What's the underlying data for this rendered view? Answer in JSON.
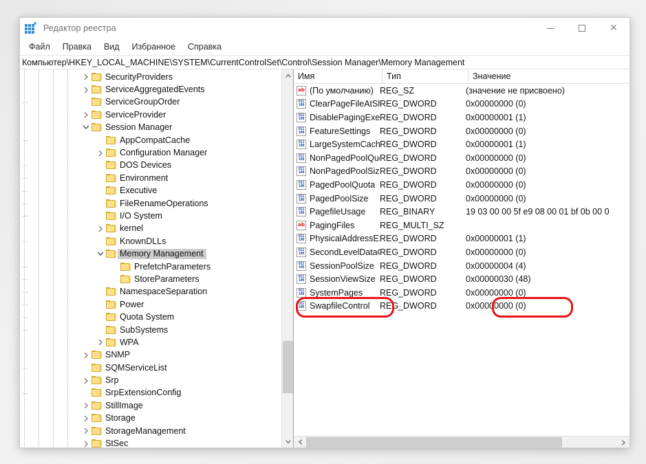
{
  "window": {
    "app_icon": "registry-editor-icon",
    "title": "Редактор реестра",
    "controls": {
      "minimize": "—",
      "maximize": "▢",
      "close": "✕"
    }
  },
  "menu": {
    "items": [
      {
        "label": "Файл"
      },
      {
        "label": "Правка"
      },
      {
        "label": "Вид"
      },
      {
        "label": "Избранное"
      },
      {
        "label": "Справка"
      }
    ]
  },
  "address": {
    "path": "Компьютер\\HKEY_LOCAL_MACHINE\\SYSTEM\\CurrentControlSet\\Control\\Session Manager\\Memory Management"
  },
  "tree": {
    "nodes": [
      {
        "label": "SecurityProviders",
        "depth": 1,
        "twist": "collapsed",
        "selected": false
      },
      {
        "label": "ServiceAggregatedEvents",
        "depth": 1,
        "twist": "collapsed",
        "selected": false
      },
      {
        "label": "ServiceGroupOrder",
        "depth": 1,
        "twist": "none",
        "selected": false
      },
      {
        "label": "ServiceProvider",
        "depth": 1,
        "twist": "collapsed",
        "selected": false
      },
      {
        "label": "Session Manager",
        "depth": 1,
        "twist": "expanded",
        "selected": false
      },
      {
        "label": "AppCompatCache",
        "depth": 2,
        "twist": "none",
        "selected": false
      },
      {
        "label": "Configuration Manager",
        "depth": 2,
        "twist": "collapsed",
        "selected": false
      },
      {
        "label": "DOS Devices",
        "depth": 2,
        "twist": "none",
        "selected": false
      },
      {
        "label": "Environment",
        "depth": 2,
        "twist": "none",
        "selected": false
      },
      {
        "label": "Executive",
        "depth": 2,
        "twist": "none",
        "selected": false
      },
      {
        "label": "FileRenameOperations",
        "depth": 2,
        "twist": "none",
        "selected": false
      },
      {
        "label": "I/O System",
        "depth": 2,
        "twist": "none",
        "selected": false
      },
      {
        "label": "kernel",
        "depth": 2,
        "twist": "collapsed",
        "selected": false
      },
      {
        "label": "KnownDLLs",
        "depth": 2,
        "twist": "none",
        "selected": false
      },
      {
        "label": "Memory Management",
        "depth": 2,
        "twist": "expanded",
        "selected": true
      },
      {
        "label": "PrefetchParameters",
        "depth": 3,
        "twist": "none",
        "selected": false
      },
      {
        "label": "StoreParameters",
        "depth": 3,
        "twist": "none",
        "selected": false
      },
      {
        "label": "NamespaceSeparation",
        "depth": 2,
        "twist": "none",
        "selected": false
      },
      {
        "label": "Power",
        "depth": 2,
        "twist": "none",
        "selected": false
      },
      {
        "label": "Quota System",
        "depth": 2,
        "twist": "none",
        "selected": false
      },
      {
        "label": "SubSystems",
        "depth": 2,
        "twist": "none",
        "selected": false
      },
      {
        "label": "WPA",
        "depth": 2,
        "twist": "collapsed",
        "selected": false
      },
      {
        "label": "SNMP",
        "depth": 1,
        "twist": "collapsed",
        "selected": false
      },
      {
        "label": "SQMServiceList",
        "depth": 1,
        "twist": "none",
        "selected": false
      },
      {
        "label": "Srp",
        "depth": 1,
        "twist": "collapsed",
        "selected": false
      },
      {
        "label": "SrpExtensionConfig",
        "depth": 1,
        "twist": "none",
        "selected": false
      },
      {
        "label": "StillImage",
        "depth": 1,
        "twist": "collapsed",
        "selected": false
      },
      {
        "label": "Storage",
        "depth": 1,
        "twist": "collapsed",
        "selected": false
      },
      {
        "label": "StorageManagement",
        "depth": 1,
        "twist": "collapsed",
        "selected": false
      },
      {
        "label": "StSec",
        "depth": 1,
        "twist": "collapsed",
        "selected": false
      }
    ]
  },
  "list": {
    "columns": [
      {
        "label": "Имя"
      },
      {
        "label": "Тип"
      },
      {
        "label": "Значение"
      }
    ],
    "rows": [
      {
        "icon": "string-value-icon",
        "name": "(По умолчанию)",
        "type": "REG_SZ",
        "value": "(значение не присвоено)"
      },
      {
        "icon": "binary-value-icon",
        "name": "ClearPageFileAtShutdown",
        "type": "REG_DWORD",
        "value": "0x00000000 (0)"
      },
      {
        "icon": "binary-value-icon",
        "name": "DisablePagingExecutive",
        "type": "REG_DWORD",
        "value": "0x00000001 (1)"
      },
      {
        "icon": "binary-value-icon",
        "name": "FeatureSettings",
        "type": "REG_DWORD",
        "value": "0x00000000 (0)"
      },
      {
        "icon": "binary-value-icon",
        "name": "LargeSystemCache",
        "type": "REG_DWORD",
        "value": "0x00000001 (1)"
      },
      {
        "icon": "binary-value-icon",
        "name": "NonPagedPoolQuota",
        "type": "REG_DWORD",
        "value": "0x00000000 (0)"
      },
      {
        "icon": "binary-value-icon",
        "name": "NonPagedPoolSize",
        "type": "REG_DWORD",
        "value": "0x00000000 (0)"
      },
      {
        "icon": "binary-value-icon",
        "name": "PagedPoolQuota",
        "type": "REG_DWORD",
        "value": "0x00000000 (0)"
      },
      {
        "icon": "binary-value-icon",
        "name": "PagedPoolSize",
        "type": "REG_DWORD",
        "value": "0x00000000 (0)"
      },
      {
        "icon": "binary-value-icon",
        "name": "PagefileUsage",
        "type": "REG_BINARY",
        "value": "19 03 00 00 5f e9 08 00 01 bf 0b 00 0"
      },
      {
        "icon": "string-value-icon",
        "name": "PagingFiles",
        "type": "REG_MULTI_SZ",
        "value": ""
      },
      {
        "icon": "binary-value-icon",
        "name": "PhysicalAddressExtension",
        "type": "REG_DWORD",
        "value": "0x00000001 (1)"
      },
      {
        "icon": "binary-value-icon",
        "name": "SecondLevelDataCache",
        "type": "REG_DWORD",
        "value": "0x00000000 (0)"
      },
      {
        "icon": "binary-value-icon",
        "name": "SessionPoolSize",
        "type": "REG_DWORD",
        "value": "0x00000004 (4)"
      },
      {
        "icon": "binary-value-icon",
        "name": "SessionViewSize",
        "type": "REG_DWORD",
        "value": "0x00000030 (48)"
      },
      {
        "icon": "binary-value-icon",
        "name": "SystemPages",
        "type": "REG_DWORD",
        "value": "0x00000000 (0)"
      },
      {
        "icon": "binary-value-icon",
        "name": "SwapfileControl",
        "type": "REG_DWORD",
        "value": "0x00000000 (0)"
      }
    ]
  },
  "annotations": {
    "color": "#e81313",
    "highlight_name": "SwapfileControl",
    "highlight_value": "0x00000000 (0)"
  }
}
